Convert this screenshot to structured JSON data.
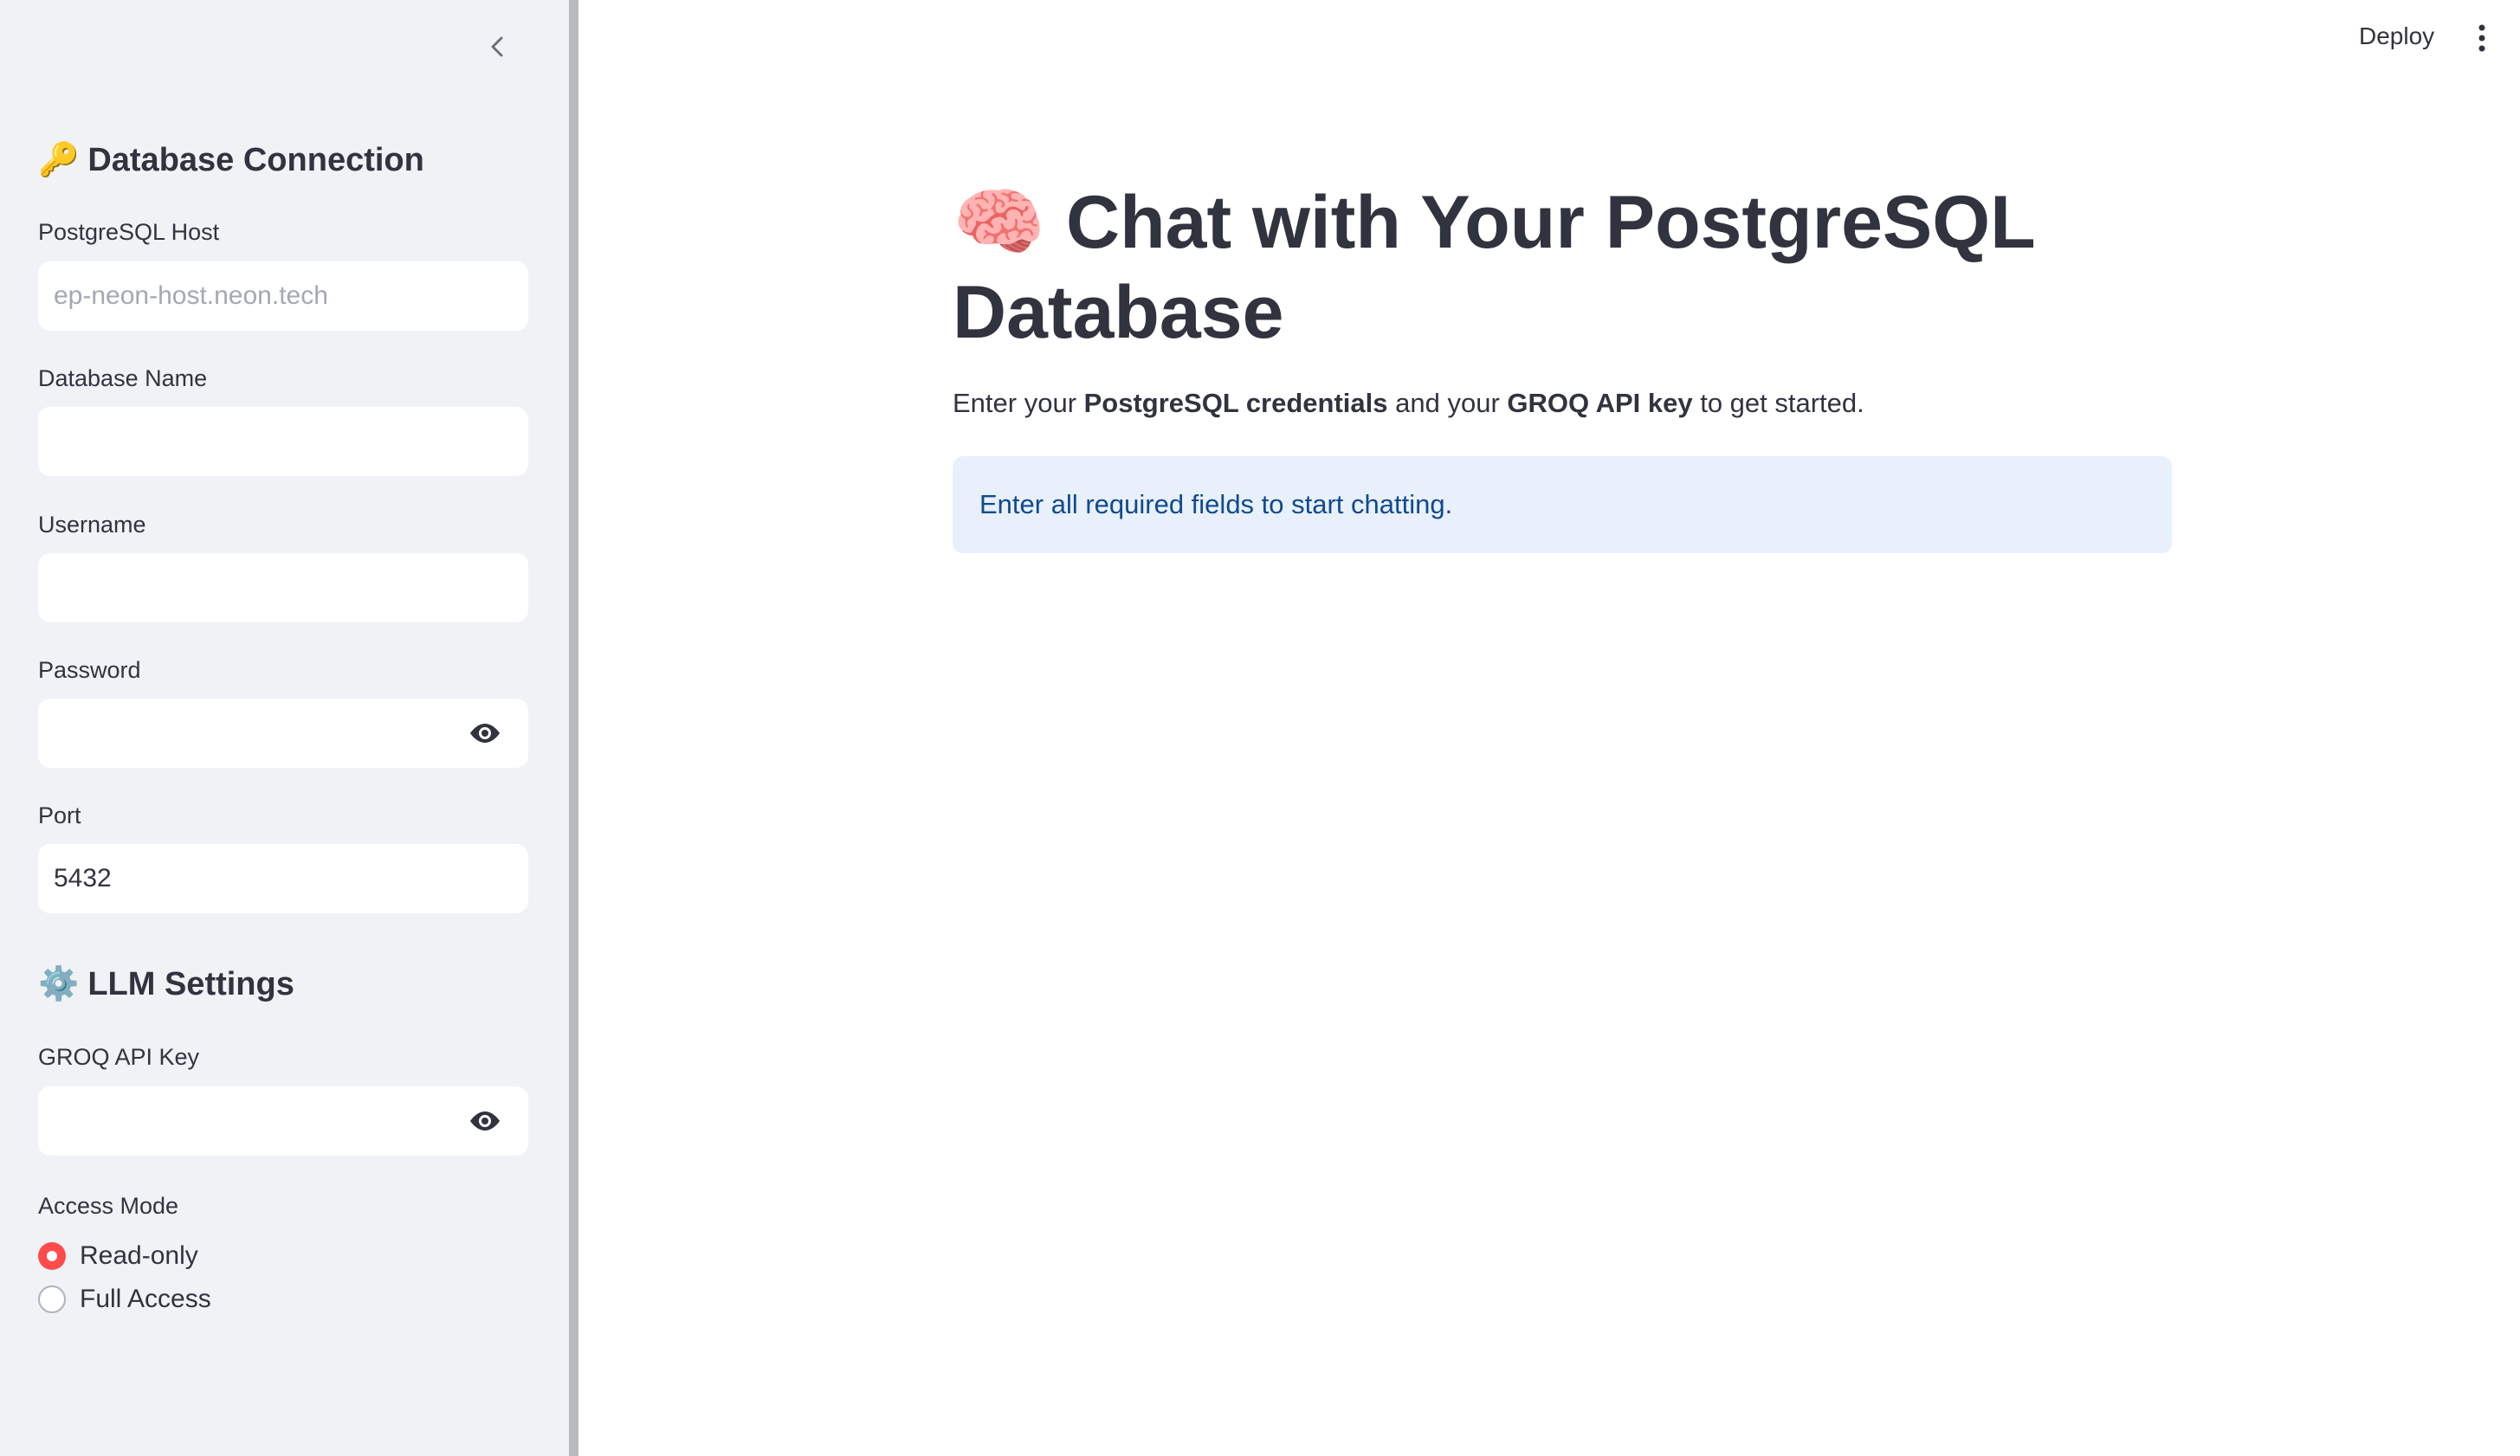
{
  "app": {
    "deploy_label": "Deploy"
  },
  "sidebar": {
    "db_section": {
      "emoji": "🔑",
      "title": "Database Connection"
    },
    "host": {
      "label": "PostgreSQL Host",
      "value": "",
      "placeholder": "ep-neon-host.neon.tech"
    },
    "dbname": {
      "label": "Database Name",
      "value": ""
    },
    "username": {
      "label": "Username",
      "value": ""
    },
    "password": {
      "label": "Password",
      "value": ""
    },
    "port": {
      "label": "Port",
      "value": "5432"
    },
    "llm_section": {
      "emoji": "⚙️",
      "title": "LLM Settings"
    },
    "groq_key": {
      "label": "GROQ API Key",
      "value": ""
    },
    "access_mode": {
      "label": "Access Mode",
      "options": [
        "Read-only",
        "Full Access"
      ],
      "selected": "Read-only"
    }
  },
  "main": {
    "title_emoji": "🧠",
    "title": "Chat with Your PostgreSQL Database",
    "subtitle": {
      "part1": "Enter your ",
      "bold1": "PostgreSQL credentials",
      "part2": " and your ",
      "bold2": "GROQ API key",
      "part3": " to get started."
    },
    "info_message": "Enter all required fields to start chatting."
  },
  "colors": {
    "sidebar_bg": "#f0f2f6",
    "accent": "#ff4b4b",
    "info_bg": "#e8f0fb",
    "info_text": "#104a8e",
    "text": "#31333f"
  }
}
